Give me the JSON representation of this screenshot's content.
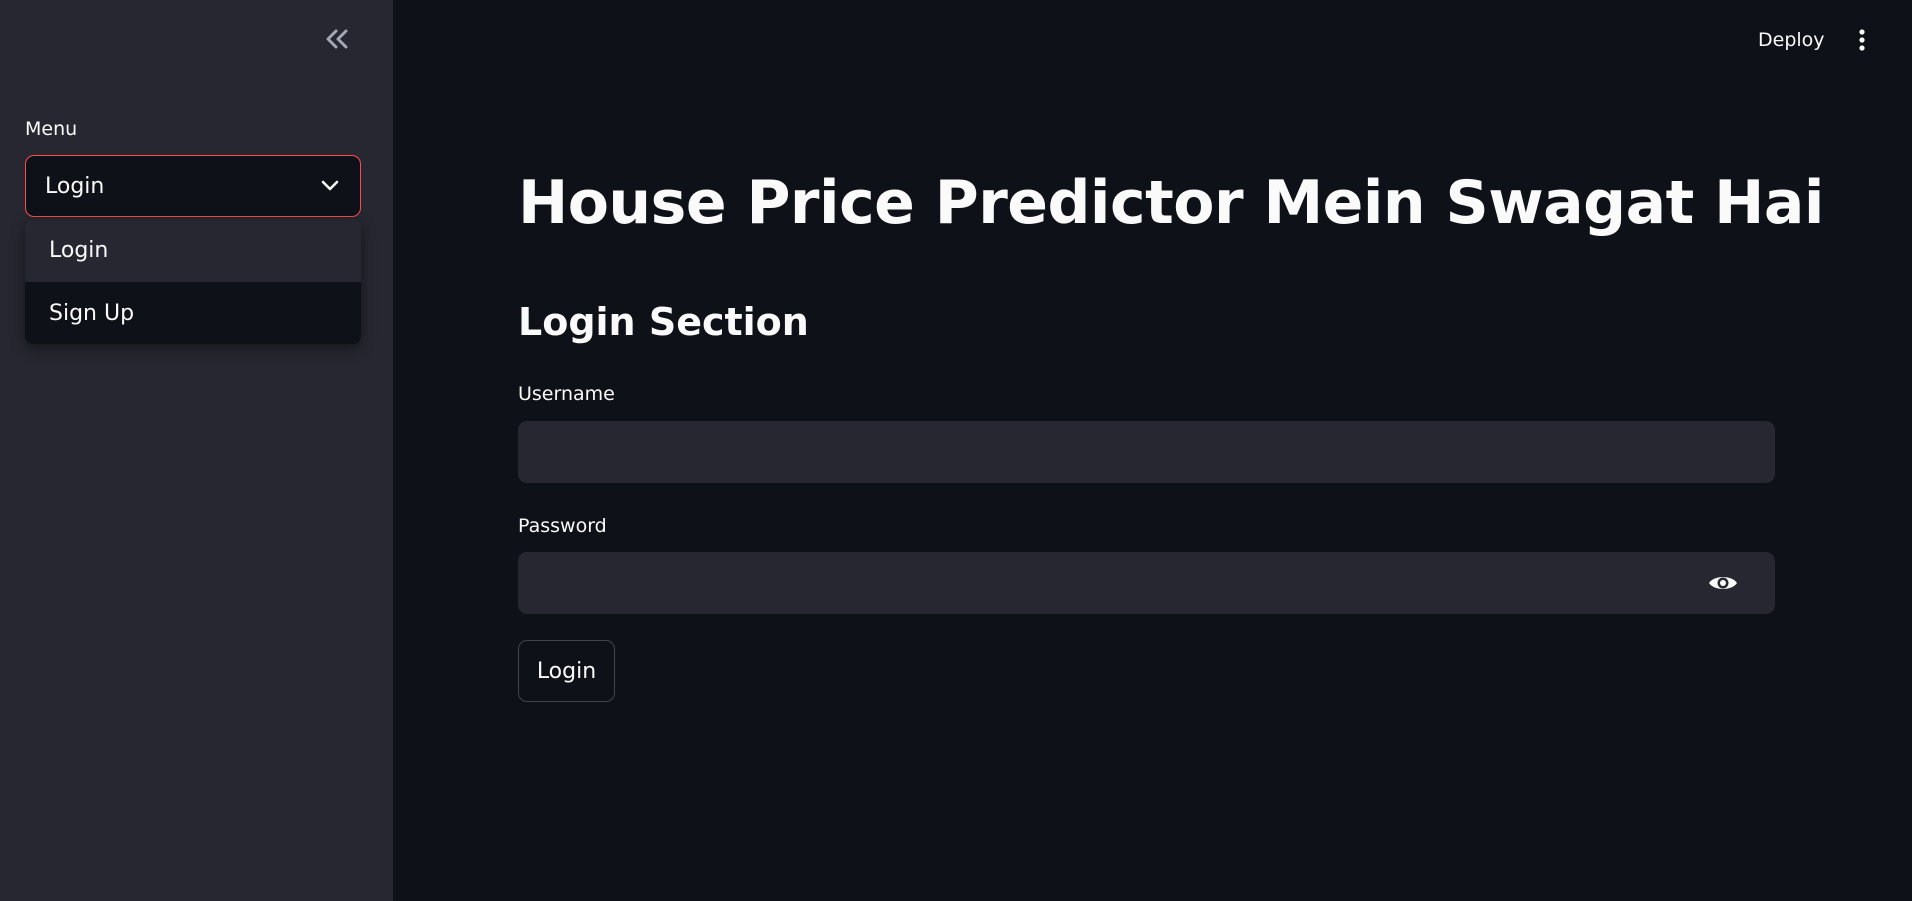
{
  "sidebar": {
    "collapse_icon": "double-chevron-left-icon",
    "menu_label": "Menu",
    "select": {
      "value": "Login",
      "icon": "chevron-down-icon",
      "border_color": "#ff4b4b",
      "options": [
        {
          "label": "Login"
        },
        {
          "label": "Sign Up"
        }
      ]
    }
  },
  "header": {
    "deploy_label": "Deploy",
    "menu_icon": "kebab-menu-icon"
  },
  "main": {
    "title": "House Price Predictor Mein Swagat Hai",
    "section_title": "Login Section",
    "username": {
      "label": "Username",
      "value": "",
      "placeholder": ""
    },
    "password": {
      "label": "Password",
      "value": "",
      "placeholder": "",
      "toggle_icon": "eye-icon"
    },
    "submit_label": "Login"
  },
  "colors": {
    "background": "#0e1117",
    "sidebar": "#262730",
    "accent": "#ff4b4b",
    "text": "#fafafa"
  }
}
